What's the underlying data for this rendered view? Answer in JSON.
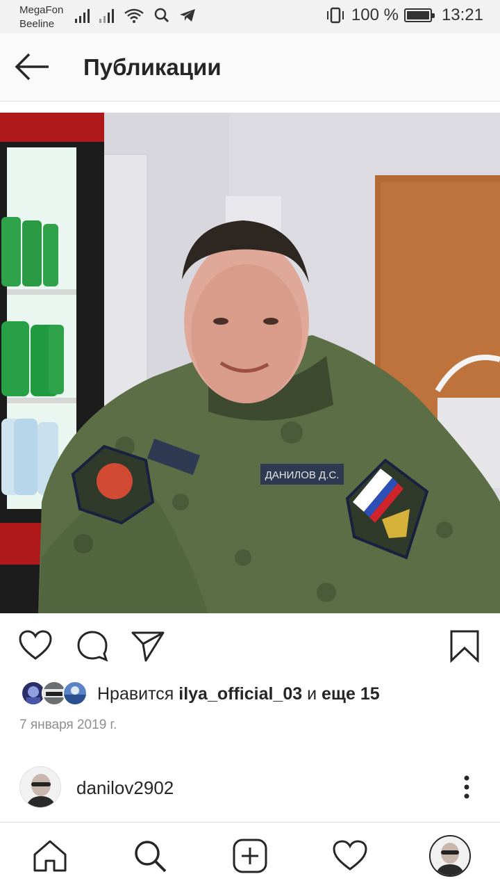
{
  "status_bar": {
    "carrier1": "MegaFon",
    "carrier2": "Beeline",
    "battery": "100 %",
    "time": "13:21"
  },
  "header": {
    "title": "Публикации"
  },
  "post": {
    "photo_name_tape": "ДАНИЛОВ Д.С.",
    "likes": {
      "prefix": "Нравится ",
      "user": "ilya_official_03",
      "conjunction": " и ",
      "rest": "еще 15"
    },
    "date": "7 января 2019 г.",
    "author": "danilov2902"
  },
  "icons": {
    "back": "arrow-left-icon",
    "like": "heart-icon",
    "comment": "comment-icon",
    "share": "send-icon",
    "save": "bookmark-icon",
    "more": "more-vertical-icon",
    "home": "home-icon",
    "search": "search-icon",
    "add": "add-post-icon",
    "activity": "heart-icon"
  }
}
